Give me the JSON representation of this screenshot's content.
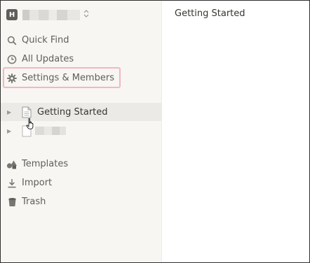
{
  "workspace": {
    "avatar_letter": "H"
  },
  "nav": [
    {
      "label": "Quick Find",
      "icon": "search-icon"
    },
    {
      "label": "All Updates",
      "icon": "clock-icon"
    },
    {
      "label": "Settings & Members",
      "icon": "gear-icon"
    }
  ],
  "pages": [
    {
      "label": "Getting Started",
      "icon": "document-icon",
      "active": true
    },
    {
      "icon": "page-icon",
      "active": false
    }
  ],
  "footer_nav": [
    {
      "label": "Templates",
      "icon": "templates-icon"
    },
    {
      "label": "Import",
      "icon": "import-icon"
    },
    {
      "label": "Trash",
      "icon": "trash-icon"
    }
  ],
  "main": {
    "title": "Getting Started"
  },
  "colors": {
    "sidebar_bg": "#f7f6f3",
    "active_row": "#ebeae7",
    "highlight_border": "#f2b7bf",
    "text": "#37352f"
  }
}
